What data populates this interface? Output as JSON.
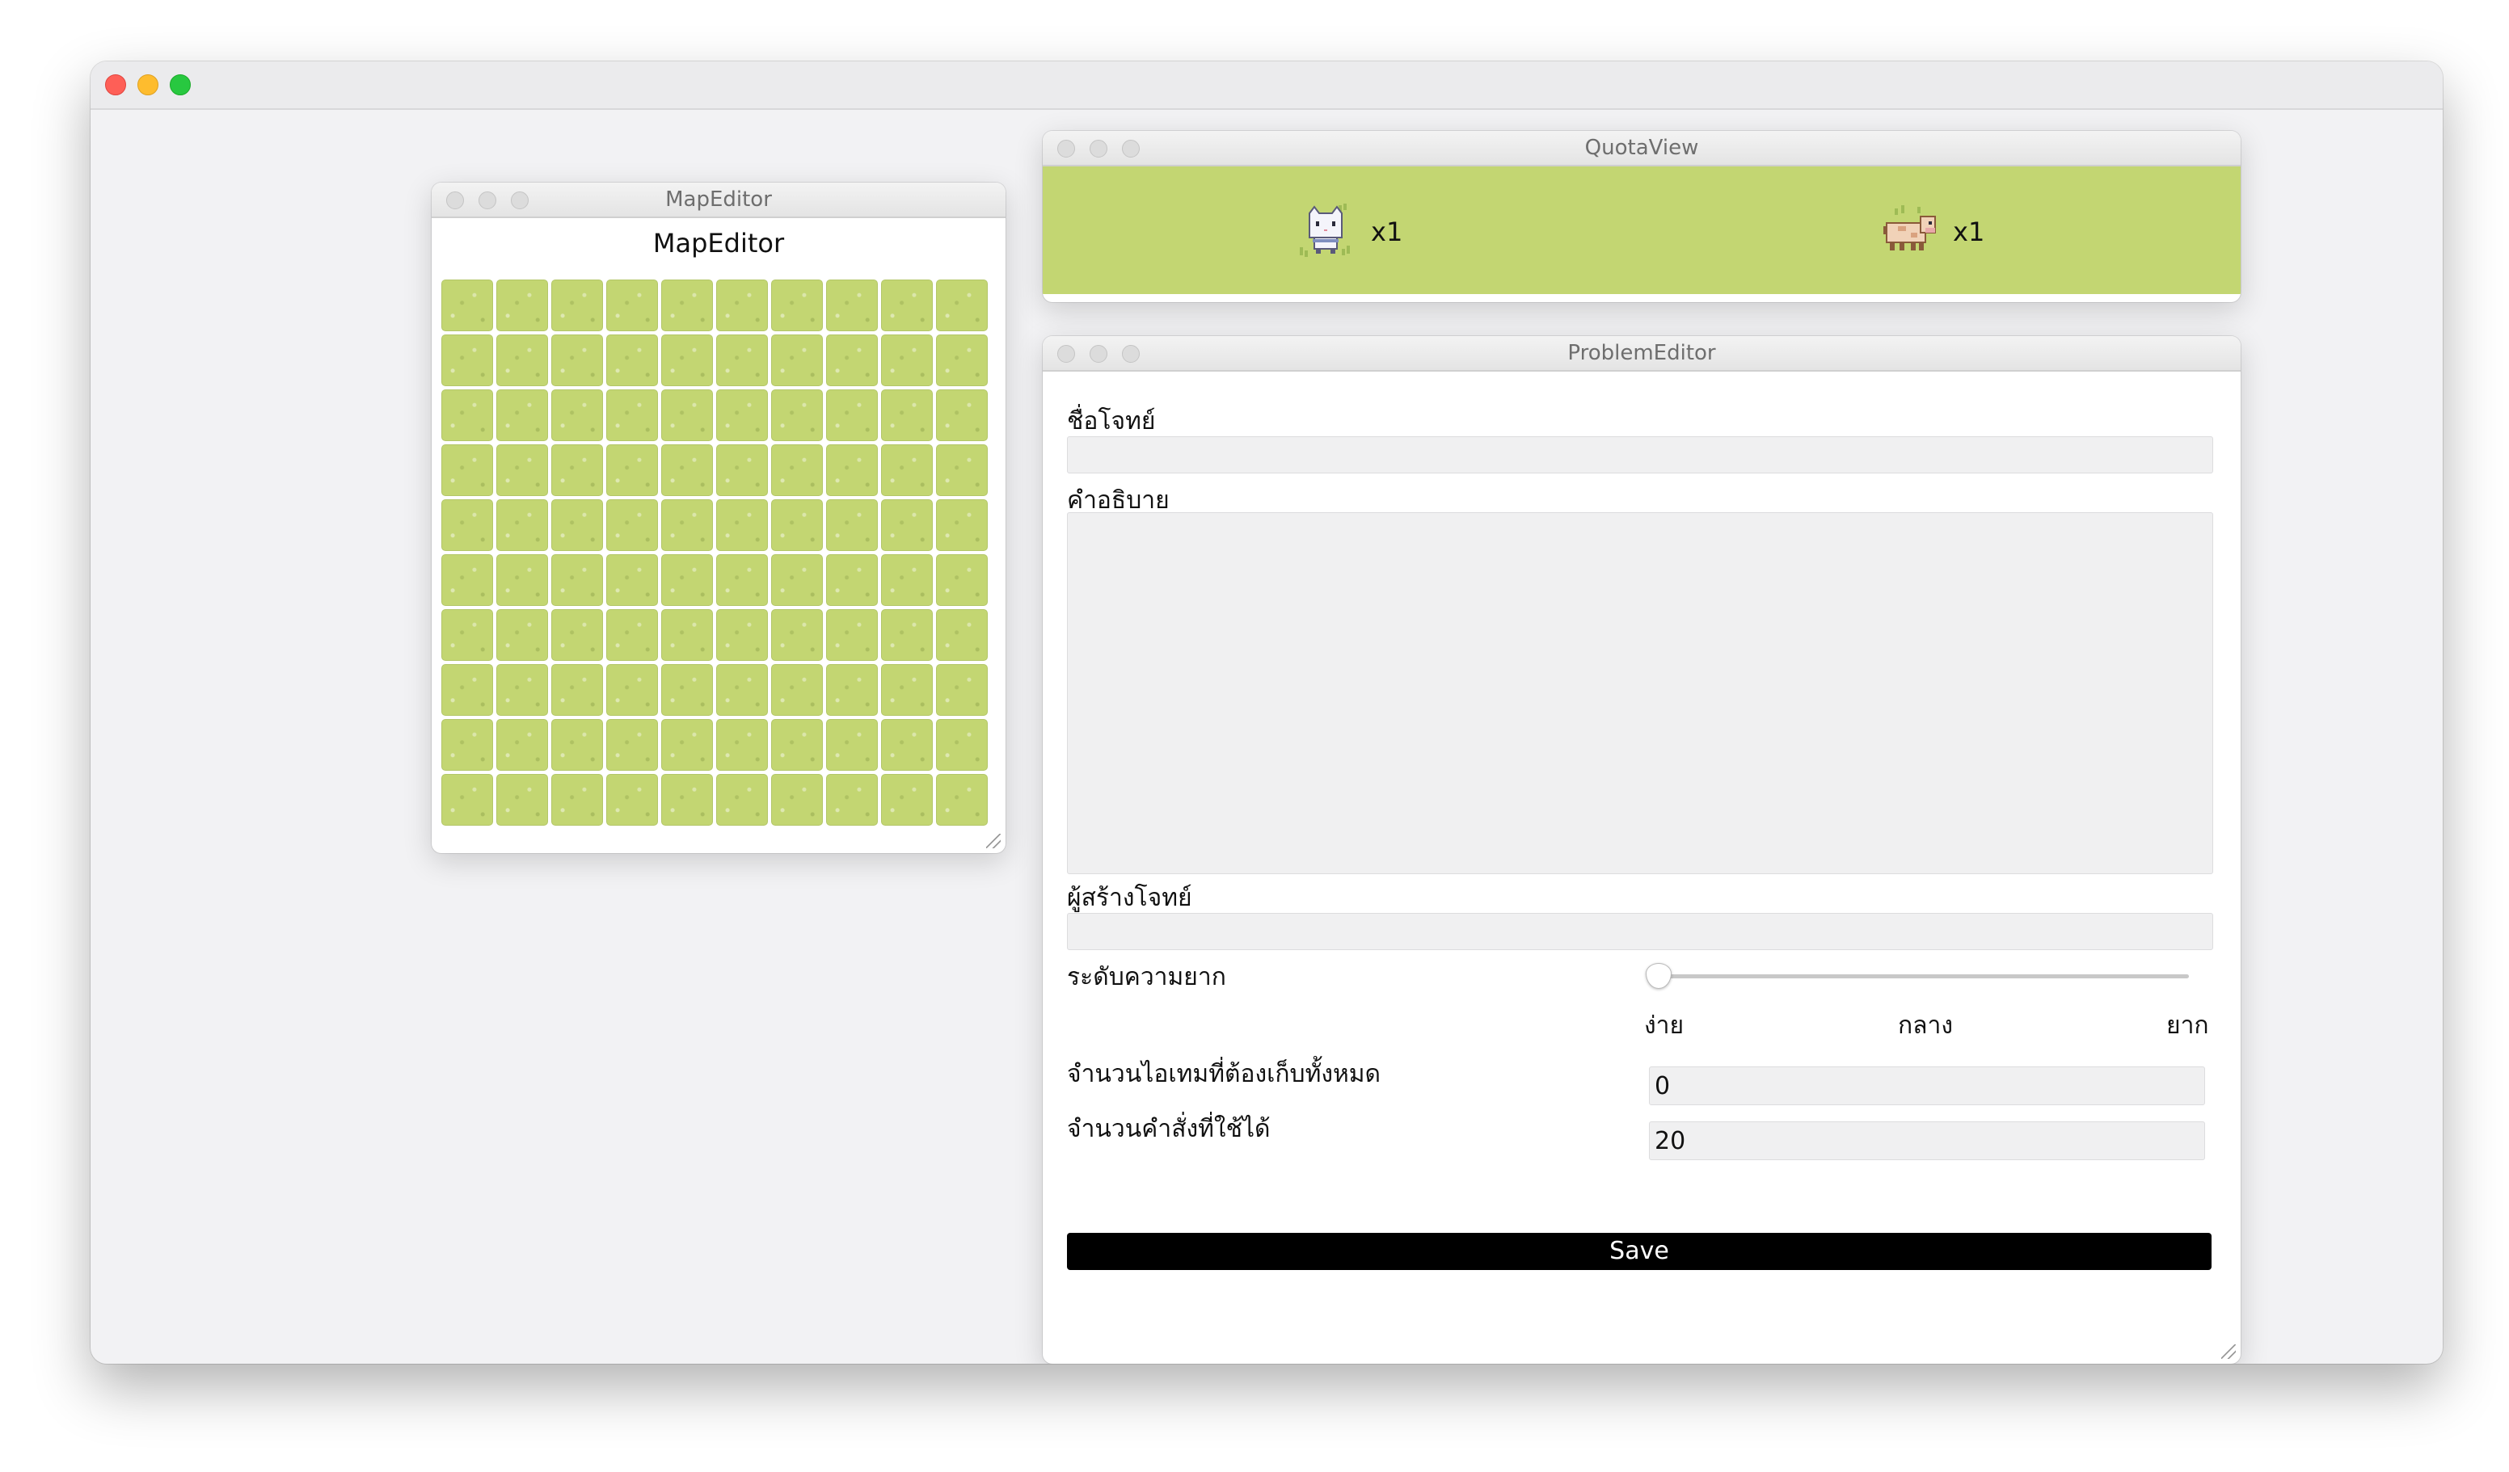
{
  "map_editor": {
    "window_title": "MapEditor",
    "heading": "MapEditor",
    "grid": {
      "rows": 10,
      "columns": 10,
      "tile": "grass"
    }
  },
  "quota_view": {
    "window_title": "QuotaView",
    "items": [
      {
        "sprite": "cat-sprite-icon",
        "count": "x1"
      },
      {
        "sprite": "cow-sprite-icon",
        "count": "x1"
      }
    ]
  },
  "problem_editor": {
    "window_title": "ProblemEditor",
    "title_label": "ชื่อโจทย์",
    "title_value": "",
    "description_label": "คำอธิบาย",
    "description_value": "",
    "author_label": "ผู้สร้างโจทย์",
    "author_value": "",
    "difficulty_label": "ระดับความยาก",
    "difficulty_levels": [
      "ง่าย",
      "กลาง",
      "ยาก"
    ],
    "difficulty_value": "ง่าย",
    "items_label": "จำนวนไอเทมที่ต้องเก็บทั้งหมด",
    "items_value": "0",
    "commands_label": "จำนวนคำสั่งที่ใช้ได้",
    "commands_value": "20",
    "save_label": "Save"
  },
  "colors": {
    "grass": "#c3d672",
    "save_button": "#000000",
    "window_background": "#f2f2f4"
  }
}
